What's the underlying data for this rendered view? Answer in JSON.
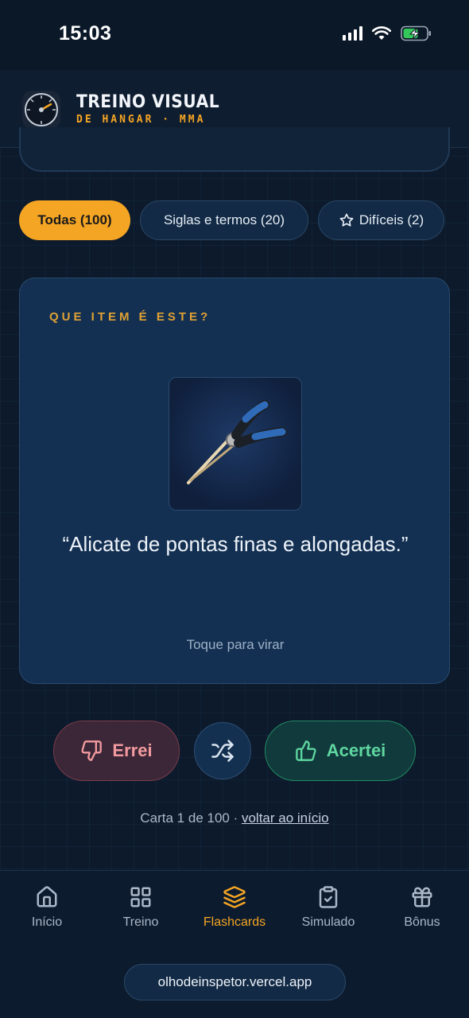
{
  "status_bar": {
    "time": "15:03",
    "signal_icon": "signal-icon",
    "wifi_icon": "wifi-icon",
    "battery_icon": "battery-charging-icon"
  },
  "header": {
    "title": "TREINO VISUAL",
    "subtitle": "DE HANGAR · MMA",
    "logo_icon": "gauge-icon"
  },
  "filters": [
    {
      "label": "Todas (100)",
      "active": true
    },
    {
      "label": "Siglas e termos (20)",
      "active": false
    },
    {
      "label": "Difíceis (2)",
      "active": false,
      "icon": "star-icon"
    }
  ],
  "card": {
    "label": "QUE ITEM É ESTE?",
    "image": "pliers-image",
    "text": "“Alicate de pontas finas e alongadas.”",
    "hint": "Toque para virar"
  },
  "actions": {
    "wrong_label": "Errei",
    "wrong_icon": "thumbs-down-icon",
    "shuffle_icon": "shuffle-icon",
    "right_label": "Acertei",
    "right_icon": "thumbs-up-icon"
  },
  "counter": {
    "text": "Carta 1 de 100 · ",
    "link": "voltar ao início"
  },
  "nav": [
    {
      "label": "Início",
      "icon": "home-icon",
      "active": false
    },
    {
      "label": "Treino",
      "icon": "grid-icon",
      "active": false
    },
    {
      "label": "Flashcards",
      "icon": "layers-icon",
      "active": true
    },
    {
      "label": "Simulado",
      "icon": "clipboard-check-icon",
      "active": false
    },
    {
      "label": "Bônus",
      "icon": "gift-icon",
      "active": false
    }
  ],
  "url": "olhodeinspetor.vercel.app",
  "colors": {
    "accent": "#f5a524",
    "wrong": "#f29a9f",
    "right": "#5fd6a0",
    "background": "#0c1a2c"
  }
}
